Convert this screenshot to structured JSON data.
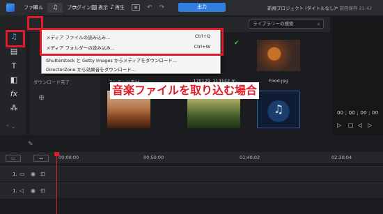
{
  "topbar": {
    "menu": [
      "ファイル",
      "編集",
      "プラグイン",
      "表示",
      "再生"
    ],
    "output_label": "出力",
    "project_title": "新規プロジェクト (タイトルなし)*",
    "saved_at": "前回保存 21:42"
  },
  "library": {
    "search_placeholder": "ライブラリーの検索",
    "tree_label": "ダウンロード完了",
    "content_label": "コンテンツ素材",
    "media_items": [
      {
        "label": "170129_113142.m..."
      },
      {
        "label": "Food.jpg"
      }
    ]
  },
  "dropdown": {
    "items": [
      {
        "label": "メディア ファイルの読み込み...",
        "shortcut": "Ctrl+Q"
      },
      {
        "label": "メディア フォルダーの読み込み...",
        "shortcut": "Ctrl+W"
      },
      {
        "label": "Shutterstock と Getty Images からメディアをダウンロード...",
        "shortcut": ""
      },
      {
        "label": "DirectorZone から効果音をダウンロード...",
        "shortcut": ""
      }
    ]
  },
  "annotation": {
    "text": "音楽ファイルを取り込む場合",
    "color": "#e21b2b"
  },
  "preview": {
    "timecode": "00 ; 00 ; 00 ; 00"
  },
  "timeline": {
    "ruler_times": [
      "00;00;00",
      "00;50;00",
      "01;40;02",
      "02;30;04"
    ],
    "tracks": [
      {
        "number": "1."
      },
      {
        "number": "1."
      }
    ]
  },
  "colors": {
    "accent": "#2f7ee0",
    "highlight": "#e21b2b"
  }
}
